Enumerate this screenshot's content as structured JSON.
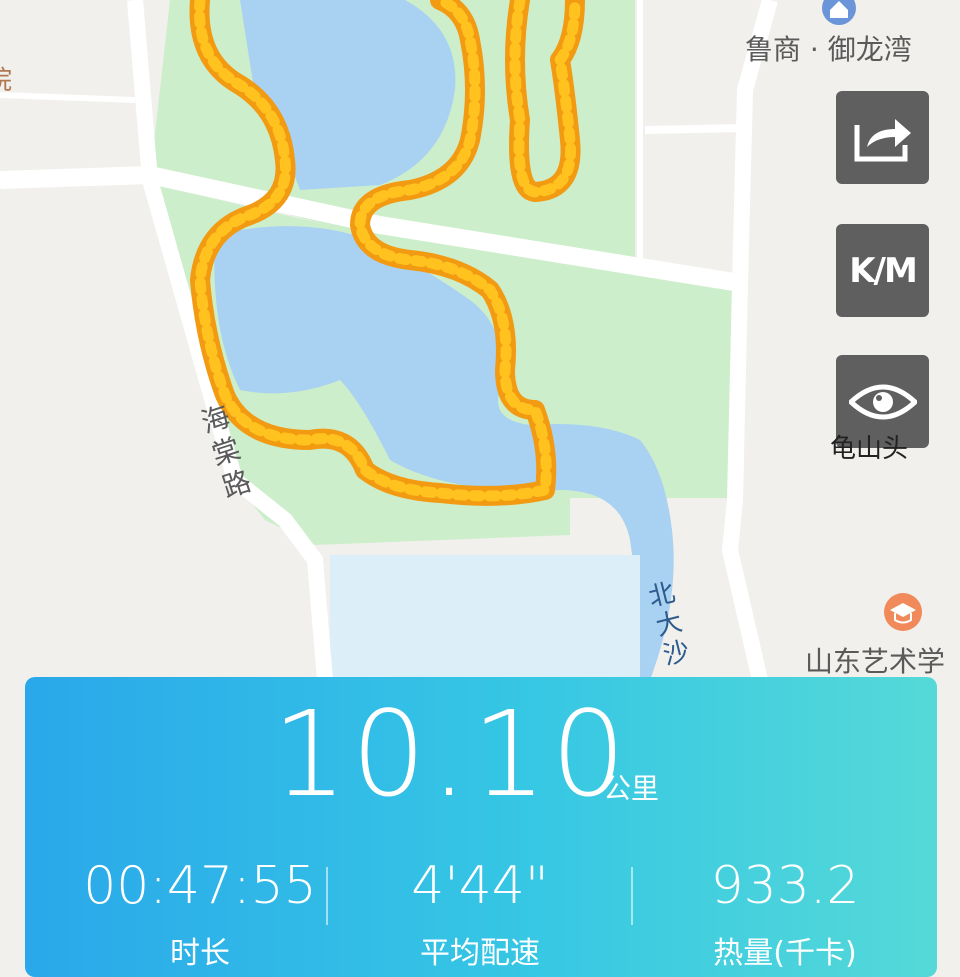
{
  "map": {
    "labels": {
      "poi_top": "鲁商 · 御龙湾",
      "road_left": "海棠路",
      "poi_right": "山东艺术学",
      "road_bottom": "北大沙",
      "guishantou": "龟山头",
      "edge_left": "院"
    },
    "icons": {
      "poi_top_icon": "house-pin-icon",
      "poi_right_icon": "graduation-cap-icon"
    }
  },
  "controls": {
    "share_icon": "share-icon",
    "km_label": "K/M",
    "eye_icon": "eye-icon"
  },
  "summary": {
    "distance": "10.10",
    "distance_unit": "公里",
    "stats": [
      {
        "value": "00:47:55",
        "label": "时长"
      },
      {
        "value": "4'44\"",
        "label": "平均配速"
      },
      {
        "value": "933.2",
        "label": "热量(千卡)"
      }
    ]
  },
  "colors": {
    "water": "#a9d1f2",
    "park": "#cdeecb",
    "road": "#ffffff",
    "route_primary": "#ffc21e",
    "route_secondary": "#f29a12",
    "panel_start": "#2aa8ea",
    "panel_end": "#55d9d8"
  }
}
